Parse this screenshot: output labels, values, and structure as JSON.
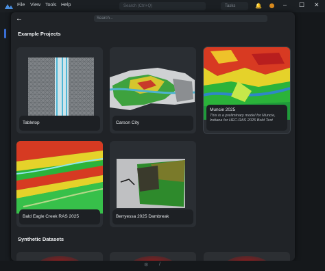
{
  "menubar": {
    "items": [
      "File",
      "View",
      "Tools",
      "Help"
    ],
    "search_placeholder": "Search (Ctrl+Q)",
    "tasks_label": "Tasks"
  },
  "window_controls": {
    "minimize": "–",
    "maximize": "☐",
    "close": "✕"
  },
  "modal": {
    "back_glyph": "←",
    "search_placeholder": "Search...",
    "sections": [
      {
        "title": "Example Projects"
      },
      {
        "title": "Synthetic Datasets"
      }
    ],
    "example_projects": [
      {
        "title": "Tabletop",
        "description": ""
      },
      {
        "title": "Carson City",
        "description": ""
      },
      {
        "title": "Muncie 2025",
        "description": "This is a preliminary model for Muncie, Indiana for HEC-RAS 2025 Bold Text"
      },
      {
        "title": "Bald Eagle Creek RAS 2025",
        "description": ""
      },
      {
        "title": "Berryessa 2025 Dambreak",
        "description": ""
      }
    ]
  },
  "status": {
    "left": "⚙",
    "right": "/"
  },
  "colors": {
    "accent": "#3a6fd6",
    "warning": "#d98a1e"
  }
}
